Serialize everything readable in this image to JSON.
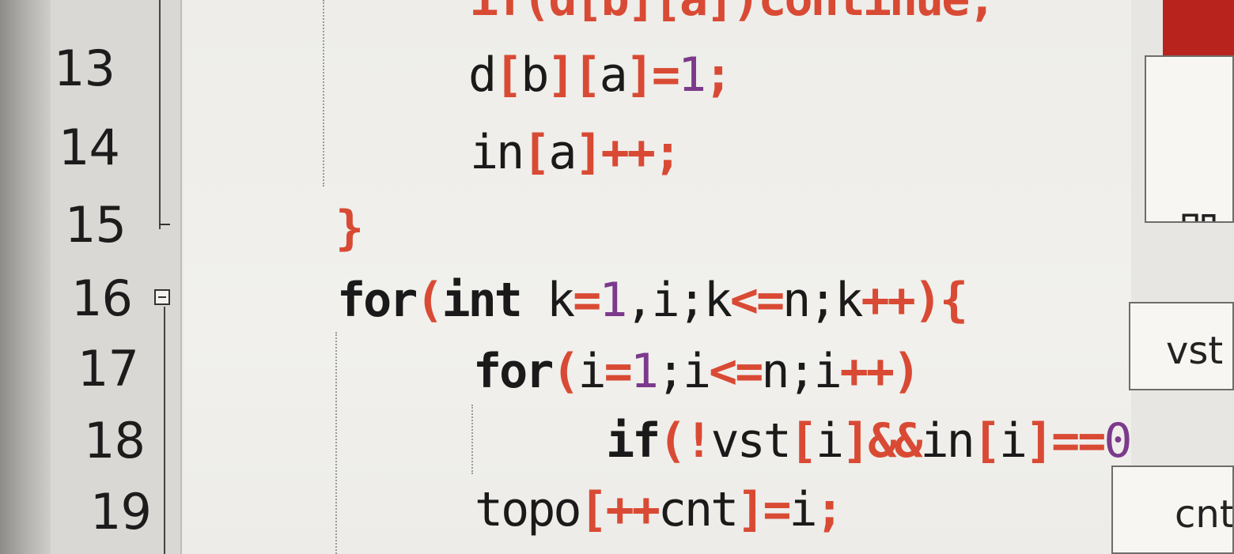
{
  "gutter": {
    "line_numbers": [
      "13",
      "14",
      "15",
      "16",
      "17",
      "18",
      "19"
    ]
  },
  "code": {
    "top_partial": "if(d[b][a])continue;",
    "l13": {
      "a": "d",
      "b": "[",
      "c": "b",
      "d": "][",
      "e": "a",
      "f": "]=",
      "g": "1",
      "h": ";"
    },
    "l14": {
      "a": "in",
      "b": "[",
      "c": "a",
      "d": "]++;"
    },
    "l15": {
      "a": "}"
    },
    "l16": {
      "a": "for",
      "b": "(",
      "c": "int",
      "d": " k",
      "e": "=",
      "f": "1",
      "g": ",i;k",
      "h": "<=",
      "i": "n;k",
      "j": "++",
      "k": "){"
    },
    "l17": {
      "a": "for",
      "b": "(",
      "c": "i",
      "d": "=",
      "e": "1",
      "f": ";i",
      "g": "<=",
      "h": "n;i",
      "i": "++",
      "j": ")"
    },
    "l18": {
      "a": "if",
      "b": "(!",
      "c": "vst",
      "d": "[",
      "e": "i",
      "f": "]&&",
      "g": "in",
      "h": "[",
      "i": "i",
      "j": "]==",
      "k": "0",
      "l": ")"
    },
    "l19": {
      "a": "topo",
      "b": "[++",
      "c": "cnt",
      "d": "]=",
      "e": "i",
      "f": ";"
    }
  },
  "right_panel": {
    "box1_text": "即",
    "box2_text": "vst",
    "box3_text": "cnt"
  },
  "colors": {
    "keyword": "#1a1a1a",
    "bracket_operator": "#d94a34",
    "number": "#7c3a8c",
    "accent_red": "#b8241d"
  }
}
